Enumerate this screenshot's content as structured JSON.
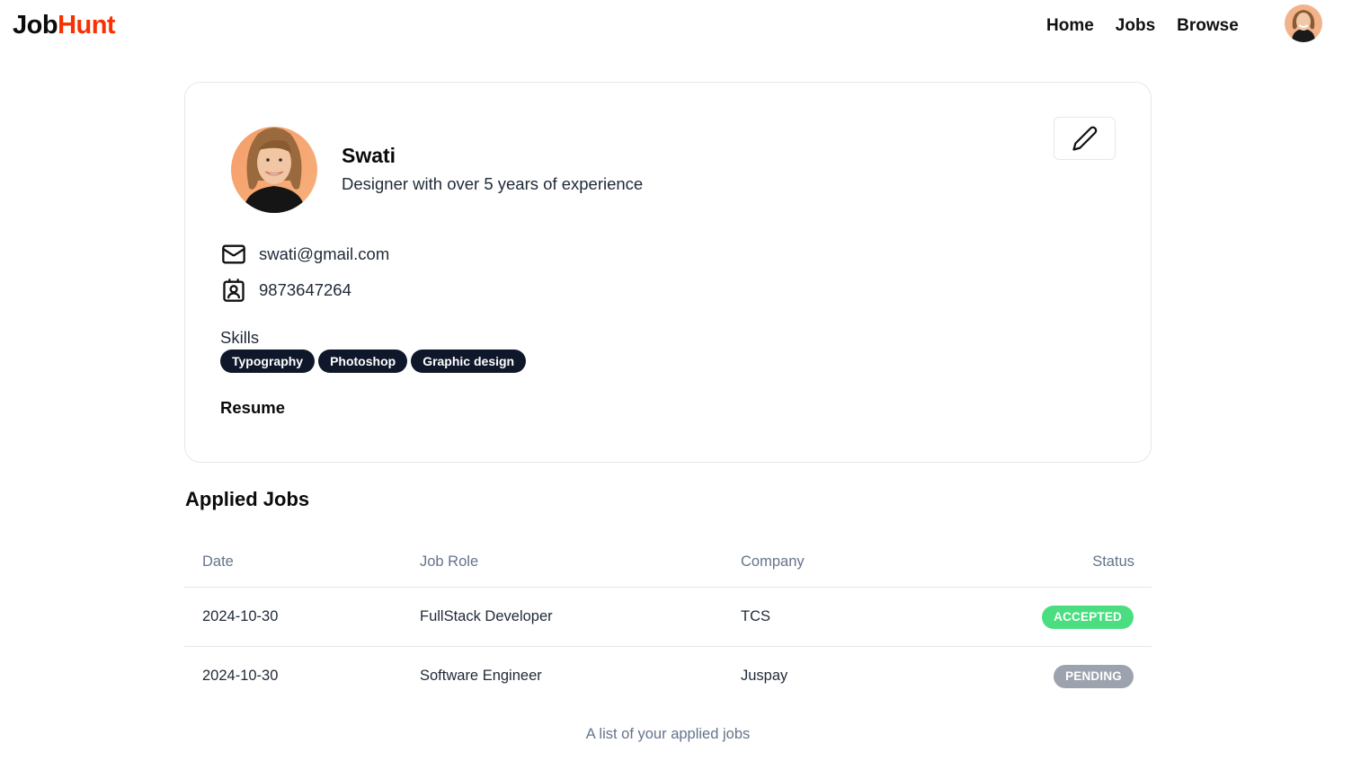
{
  "navbar": {
    "logo_part1": "Job",
    "logo_part2": "Hunt",
    "links": [
      "Home",
      "Jobs",
      "Browse"
    ]
  },
  "profile": {
    "name": "Swati",
    "bio": "Designer with over 5 years of experience",
    "email": "swati@gmail.com",
    "phone": "9873647264",
    "skills_label": "Skills",
    "skills": [
      "Typography",
      "Photoshop",
      "Graphic design"
    ],
    "resume_label": "Resume"
  },
  "applied_jobs": {
    "title": "Applied Jobs",
    "columns": [
      "Date",
      "Job Role",
      "Company",
      "Status"
    ],
    "rows": [
      {
        "date": "2024-10-30",
        "role": "FullStack Developer",
        "company": "TCS",
        "status": "ACCEPTED",
        "status_color": "#4ade80"
      },
      {
        "date": "2024-10-30",
        "role": "Software Engineer",
        "company": "Juspay",
        "status": "PENDING",
        "status_color": "#9ca3af"
      }
    ],
    "caption": "A list of your applied jobs"
  },
  "colors": {
    "brand_accent": "#f83002",
    "badge_dark": "#0f172a"
  },
  "icons": [
    "pen-icon",
    "mail-icon",
    "contact-icon"
  ]
}
